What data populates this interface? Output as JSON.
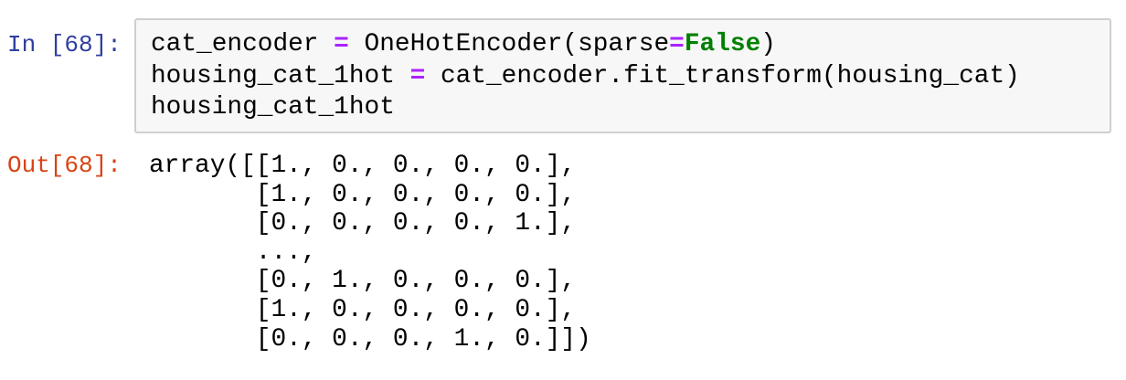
{
  "input_cell": {
    "prompt": "In [68]:",
    "lines": [
      {
        "a": "cat_encoder ",
        "op": "=",
        "b": " OneHotEncoder(sparse",
        "op2": "=",
        "kw": "False",
        "c": ")"
      },
      {
        "a": "housing_cat_1hot ",
        "op": "=",
        "b": " cat_encoder.fit_transform(housing_cat)"
      },
      {
        "a": "housing_cat_1hot"
      }
    ]
  },
  "output_cell": {
    "prompt": "Out[68]:",
    "lines": [
      "array([[1., 0., 0., 0., 0.],",
      "       [1., 0., 0., 0., 0.],",
      "       [0., 0., 0., 0., 1.],",
      "       ...,",
      "       [0., 1., 0., 0., 0.],",
      "       [1., 0., 0., 0., 0.],",
      "       [0., 0., 0., 1., 0.]])"
    ]
  },
  "colors": {
    "in_prompt": "#303f9f",
    "out_prompt": "#d84315",
    "operator": "#aa22ff",
    "keyword": "#008000"
  }
}
